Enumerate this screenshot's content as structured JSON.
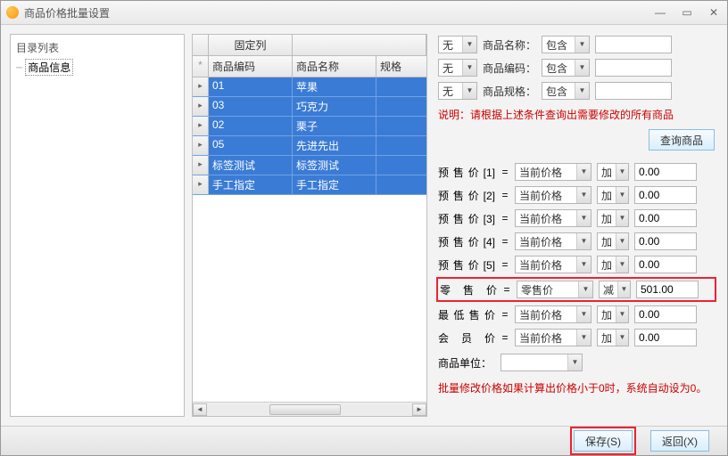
{
  "window": {
    "title": "商品价格批量设置"
  },
  "tree": {
    "header": "目录列表",
    "root": "商品信息"
  },
  "grid": {
    "fixedColLabel": "固定列",
    "headers": {
      "code": "商品编码",
      "name": "商品名称",
      "spec": "规格"
    },
    "rows": [
      {
        "code": "01",
        "name": "苹果",
        "spec": ""
      },
      {
        "code": "03",
        "name": "巧克力",
        "spec": ""
      },
      {
        "code": "02",
        "name": "栗子",
        "spec": ""
      },
      {
        "code": "05",
        "name": "先进先出",
        "spec": ""
      },
      {
        "code": "标签测试",
        "name": "标签测试",
        "spec": ""
      },
      {
        "code": "手工指定",
        "name": "手工指定",
        "spec": ""
      }
    ]
  },
  "filters": {
    "none": "无",
    "include": "包含",
    "f1label": "商品名称：",
    "f2label": "商品编码：",
    "f3label": "商品规格：",
    "note": "说明：请根据上述条件查询出需要修改的所有商品",
    "queryBtn": "查询商品"
  },
  "prices": {
    "basisCurrent": "当前价格",
    "basisRetail": "零售价",
    "opAdd": "加",
    "opSub": "减",
    "rows": [
      {
        "label": "预售价[1]",
        "basis": "当前价格",
        "op": "加",
        "val": "0.00"
      },
      {
        "label": "预售价[2]",
        "basis": "当前价格",
        "op": "加",
        "val": "0.00"
      },
      {
        "label": "预售价[3]",
        "basis": "当前价格",
        "op": "加",
        "val": "0.00"
      },
      {
        "label": "预售价[4]",
        "basis": "当前价格",
        "op": "加",
        "val": "0.00"
      },
      {
        "label": "预售价[5]",
        "basis": "当前价格",
        "op": "加",
        "val": "0.00"
      },
      {
        "label": "零 售 价",
        "basis": "零售价",
        "op": "减",
        "val": "501.00",
        "highlight": true
      },
      {
        "label": "最低售价",
        "basis": "当前价格",
        "op": "加",
        "val": "0.00"
      },
      {
        "label": "会 员 价",
        "basis": "当前价格",
        "op": "加",
        "val": "0.00"
      }
    ],
    "unitLabel": "商品单位：",
    "note2": "批量修改价格如果计算出价格小于0时，系统自动设为0。"
  },
  "footer": {
    "save": "保存(S)",
    "back": "返回(X)"
  }
}
